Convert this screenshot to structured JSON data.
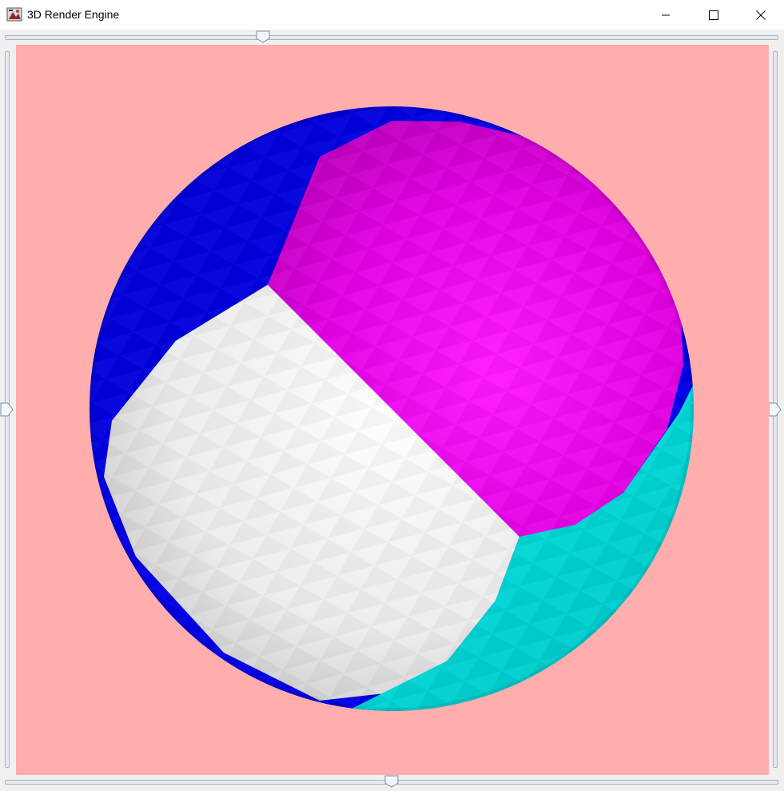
{
  "window": {
    "title": "3D Render Engine",
    "controls": [
      "minimize-icon",
      "maximize-icon",
      "close-icon"
    ]
  },
  "sliders": {
    "top": {
      "value": 0.33
    },
    "bottom": {
      "value": 0.5
    },
    "left": {
      "value": 0.5
    },
    "right": {
      "value": 0.5
    }
  },
  "scene": {
    "background": "#ffadad",
    "object": "sphere",
    "face_colors": {
      "blue": "#0000dd",
      "magenta": "#ee00ee",
      "white": "#f2f2f2",
      "cyan": "#00dddd"
    }
  }
}
